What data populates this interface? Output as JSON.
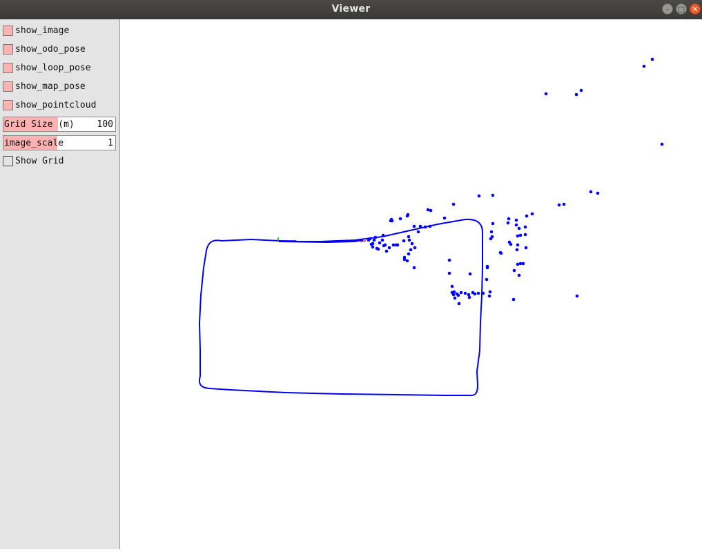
{
  "window": {
    "title": "Viewer"
  },
  "window_controls": {
    "minimize": "–",
    "maximize": "□",
    "close": "✕"
  },
  "panel": {
    "checkboxes": [
      {
        "label": "show_image",
        "checked": true
      },
      {
        "label": "show_odo_pose",
        "checked": true
      },
      {
        "label": "show_loop_pose",
        "checked": true
      },
      {
        "label": "show_map_pose",
        "checked": true
      },
      {
        "label": "show_pointcloud",
        "checked": true
      }
    ],
    "grid_size": {
      "label": "Grid Size (m)",
      "value": "100",
      "fill_fraction": 0.49
    },
    "image_scale": {
      "label": "image_scale",
      "value": "1",
      "fill_fraction": 0.48
    },
    "show_grid": {
      "label": "Show Grid",
      "checked": false
    }
  },
  "colors": {
    "trajectory": "#0000ee",
    "points": "#0000ff",
    "origin_x": "#ff0000",
    "origin_y": "#00aa00"
  }
}
